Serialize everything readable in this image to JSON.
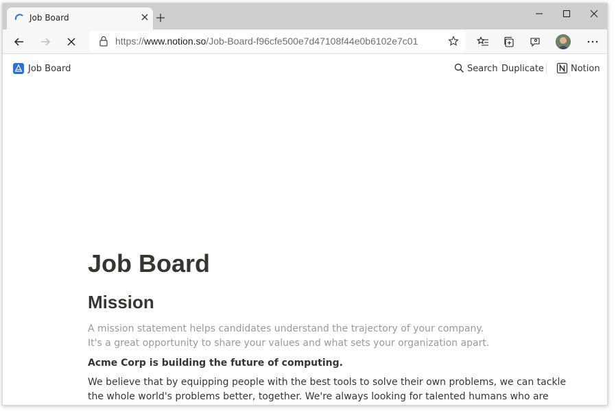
{
  "browser": {
    "tab_title": "Job Board",
    "url_prefix": "https://",
    "url_host": "www.notion.so",
    "url_path": "/Job-Board-f96cfe500e7d47108f44e0b6102e7c01"
  },
  "notion_bar": {
    "page_title": "Job Board",
    "search_label": "Search",
    "duplicate_label": "Duplicate",
    "notion_label": "Notion"
  },
  "page": {
    "title": "Job Board",
    "heading": "Mission",
    "placeholder_line1": "A mission statement helps candidates understand the trajectory of your company.",
    "placeholder_line2": "It's a great opportunity to share your values and what sets your organization apart.",
    "bold_line": "Acme Corp is building the future of computing.",
    "body_line1": "We believe that by equipping people with the best tools to solve their own problems, we can tackle",
    "body_line2": "the whole world's problems better, together. We're always looking for talented humans who are"
  },
  "colors": {
    "accent": "#2d6fdd",
    "text": "#37352f",
    "muted": "#9b9a97"
  }
}
